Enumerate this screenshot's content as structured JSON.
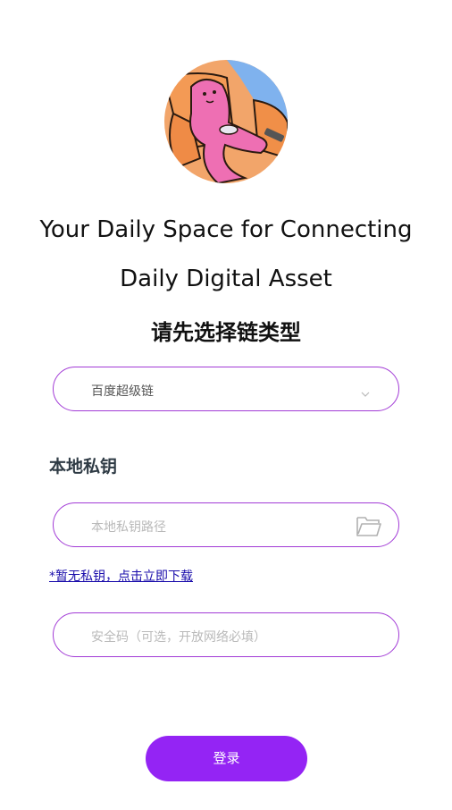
{
  "header": {
    "tagline_line1": "Your Daily Space for Connecting",
    "tagline_line2": "Daily Digital Asset",
    "chain_heading": "请先选择链类型"
  },
  "chain_select": {
    "selected_value": "百度超级链",
    "icon": "chevron-down-icon"
  },
  "private_key": {
    "label": "本地私钥",
    "path_placeholder": "本地私钥路径",
    "icon": "folder-icon",
    "download_link": "*暂无私钥，点击立即下载"
  },
  "security_code": {
    "placeholder": "安全码（可选，开放网络必填）"
  },
  "login": {
    "label": "登录"
  },
  "colors": {
    "accent": "#9424f4",
    "border": "#a23bd6",
    "link": "#1a0dab"
  }
}
